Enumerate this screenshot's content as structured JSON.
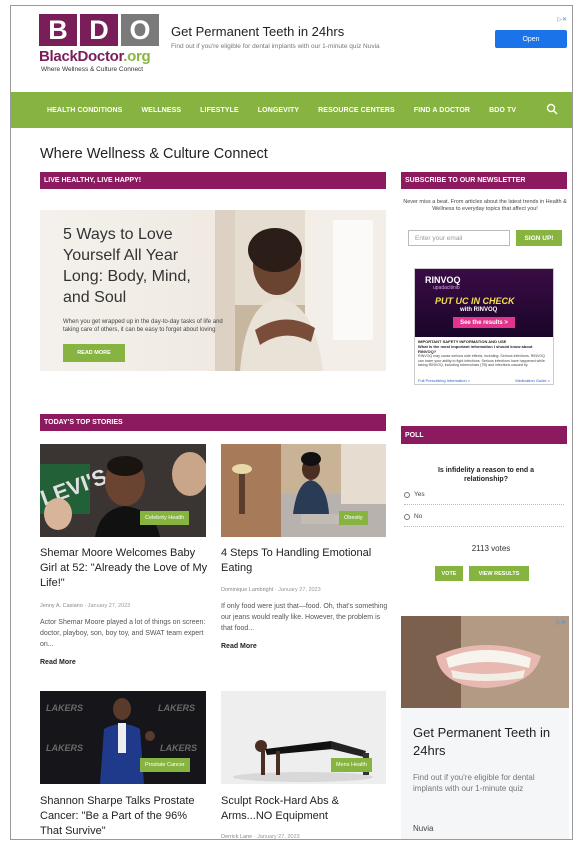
{
  "logo": {
    "letters": [
      "B",
      "D",
      "O"
    ],
    "brand_a": "BlackDoctor",
    "brand_b": ".org",
    "tagline": "Where Wellness & Culture Connect"
  },
  "top_ad": {
    "headline": "Get Permanent Teeth in 24hrs",
    "subtext": "Find out if you're eligible for dental implants with our 1-minute quiz Nuvia",
    "button": "Open"
  },
  "nav": {
    "items": [
      "HEALTH CONDITIONS",
      "WELLNESS",
      "LIFESTYLE",
      "LONGEVITY",
      "RESOURCE CENTERS",
      "FIND A DOCTOR",
      "BDO TV"
    ],
    "search_icon": "search-icon"
  },
  "page_title": "Where Wellness & Culture Connect",
  "sections": {
    "live_healthy": "LIVE HEALTHY, LIVE HAPPY!",
    "newsletter": "SUBSCRIBE TO OUR NEWSLETTER",
    "top_stories": "TODAY'S TOP STORIES",
    "poll": "POLL"
  },
  "hero": {
    "headline": "5 Ways to Love Yourself All Year Long: Body, Mind, and Soul",
    "excerpt": "When you get wrapped up in the day-to-day tasks of life and taking care of others, it can be easy to forget about loving",
    "button": "READ MORE"
  },
  "newsletter": {
    "text": "Never miss a beat. From articles about the latest trends in Health & Wellness to everyday topics that affect you!",
    "placeholder": "Enter your email",
    "button": "SIGN UP!"
  },
  "rinvoq_ad": {
    "logo": "RINVOQ",
    "logo_sub": "upadacitinib",
    "headline": "PUT UC IN CHECK",
    "with": "with RINVOQ",
    "cta": "See the results >",
    "safety_title": "IMPORTANT SAFETY INFORMATION AND USE",
    "safety_q": "What is the most important information I should know about RINVOQ?",
    "safety_body": "RINVOQ may cause serious side effects, including: Serious infections. RINVOQ can lower your ability to fight infections. Serious infections have happened while taking RINVOQ, including tuberculosis (TB) and infections caused by",
    "link_a": "Full Prescribing Information >",
    "link_b": "Medication Guide >"
  },
  "stories": [
    {
      "category": "Celebrity Health",
      "title": "Shemar Moore Welcomes Baby Girl at 52: \"Already the Love of My Life!\"",
      "author": "Jenny A. Casiano",
      "date": "January 27, 2023",
      "excerpt": "Actor Shemar Moore played a lot of things on screen: doctor, playboy, son, boy toy, and SWAT team expert on...",
      "more": "Read More"
    },
    {
      "category": "Obesity",
      "title": "4 Steps To Handling Emotional Eating",
      "author": "Dominique Lambright",
      "date": "January 27, 2023",
      "excerpt": "If only food were just that—food. Oh, that's something our jeans would really like. However, the problem is that food...",
      "more": "Read More"
    },
    {
      "category": "Prostate Cancer",
      "title": "Shannon Sharpe Talks Prostate Cancer: \"Be a Part of the 96% That Survive\""
    },
    {
      "category": "Mens Health",
      "title": "Sculpt Rock-Hard Abs & Arms...NO Equipment",
      "author": "Derrick Lane",
      "date": "January 27, 2023"
    }
  ],
  "poll": {
    "question": "Is infidelity a reason to end a relationship?",
    "options": [
      "Yes",
      "No"
    ],
    "votes": "2113 votes",
    "vote_button": "VOTE",
    "results_button": "VIEW RESULTS"
  },
  "side_ad": {
    "headline": "Get Permanent Teeth in 24hrs",
    "subtext": "Find out if you're eligible for dental implants with our 1-minute quiz",
    "advertiser": "Nuvia"
  },
  "colors": {
    "brand_purple": "#8b1a5e",
    "brand_green": "#87b441",
    "ad_blue": "#1a73e8"
  }
}
